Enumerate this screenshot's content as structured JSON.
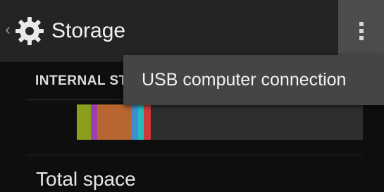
{
  "action_bar": {
    "title": "Storage",
    "up_icon": "chevron-left-icon",
    "app_icon": "gear-icon",
    "overflow_icon": "more-vertical-icon"
  },
  "overflow_menu": {
    "items": [
      {
        "label": "USB computer connection"
      }
    ]
  },
  "internal_storage": {
    "header": "INTERNAL ST",
    "usage_bar": {
      "segments": [
        {
          "color": "#8b9f1c"
        },
        {
          "color": "#9c3fb0"
        },
        {
          "color": "#b8662f"
        },
        {
          "color": "#3f8fd0"
        },
        {
          "color": "#27bdbd"
        },
        {
          "color": "#cc3a3a"
        }
      ],
      "free_color": "#2e2e2e"
    },
    "rows": [
      {
        "label": "Total space"
      }
    ]
  },
  "colors": {
    "action_bar": "#242424",
    "background": "#0e0e0e",
    "popup": "#454545"
  }
}
